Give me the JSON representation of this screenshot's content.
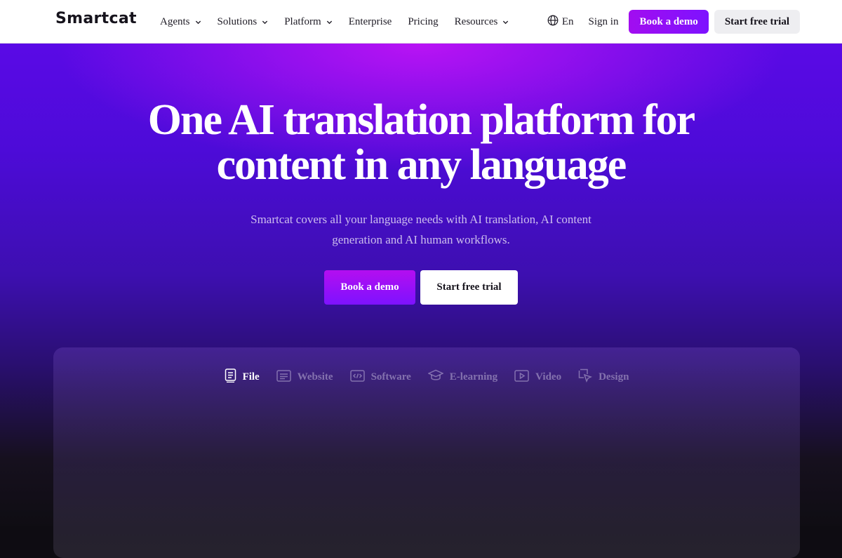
{
  "nav": {
    "logo": "Smartcat",
    "menu": [
      {
        "label": "Agents",
        "dropdown": true
      },
      {
        "label": "Solutions",
        "dropdown": true
      },
      {
        "label": "Platform",
        "dropdown": true
      },
      {
        "label": "Enterprise",
        "dropdown": false
      },
      {
        "label": "Pricing",
        "dropdown": false
      },
      {
        "label": "Resources",
        "dropdown": true
      }
    ],
    "language": "En",
    "sign_in": "Sign in",
    "book_demo": "Book a demo",
    "start_trial": "Start free trial"
  },
  "hero": {
    "title_line1": "One AI translation platform for",
    "title_line2": "content in any language",
    "subtitle": "Smartcat covers all your language needs with AI translation, AI content generation and AI human workflows.",
    "book_demo": "Book a demo",
    "start_trial": "Start free trial"
  },
  "panel": {
    "tabs": [
      {
        "label": "File",
        "icon": "file-icon",
        "active": true
      },
      {
        "label": "Website",
        "icon": "website-icon",
        "active": false
      },
      {
        "label": "Software",
        "icon": "code-icon",
        "active": false
      },
      {
        "label": "E-learning",
        "icon": "graduation-cap-icon",
        "active": false
      },
      {
        "label": "Video",
        "icon": "play-icon",
        "active": false
      },
      {
        "label": "Design",
        "icon": "design-icon",
        "active": false
      }
    ]
  },
  "colors": {
    "accent_purple": "#a20df0",
    "accent_violet": "#7d12ff",
    "hero_deep": "#4d0bd8",
    "text_dark": "#16131c"
  }
}
